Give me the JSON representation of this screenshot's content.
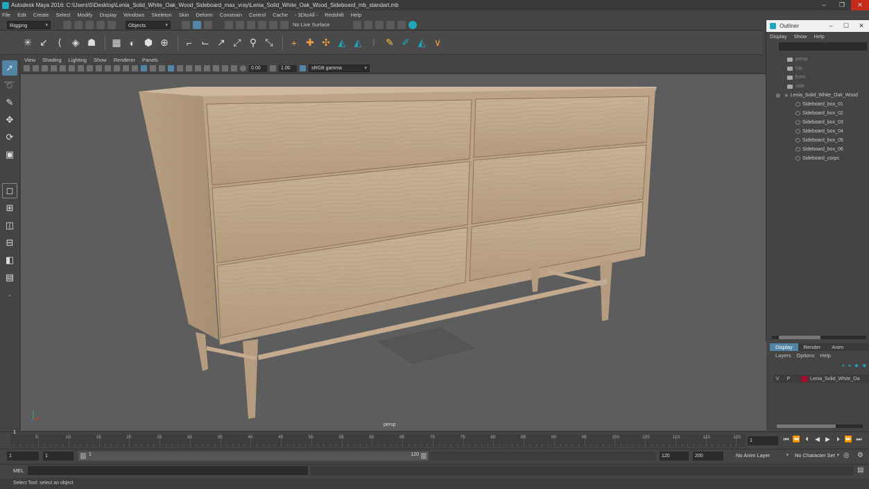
{
  "title": "Autodesk Maya 2016: C:\\Users\\5\\Desktop\\Lenia_Solid_White_Oak_Wood_Sideboard_max_vray\\Lenia_Solid_White_Oak_Wood_Sideboard_mb_standart.mb",
  "menus": [
    "File",
    "Edit",
    "Create",
    "Select",
    "Modify",
    "Display",
    "Windows",
    "Skeleton",
    "Skin",
    "Deform",
    "Constrain",
    "Control",
    "Cache",
    "- 3DtoAll -",
    "Redshift",
    "Help"
  ],
  "statusline": {
    "mode": "Rigging",
    "objects": "Objects",
    "live_surface": "No Live Surface"
  },
  "panel_menus": [
    "View",
    "Shading",
    "Lighting",
    "Show",
    "Renderer",
    "Panels"
  ],
  "panel_toolbar": {
    "exposure": "0.00",
    "gamma": "1.00",
    "colorspace": "sRGB gamma"
  },
  "viewport": {
    "camera_label": "persp"
  },
  "outliner": {
    "title": "Outliner",
    "menus": [
      "Display",
      "Show",
      "Help"
    ],
    "cameras": [
      "persp",
      "top",
      "front",
      "side"
    ],
    "group": "Lenia_Solid_White_Oak_Wood",
    "children": [
      "Sideboard_box_01",
      "Sideboard_box_02",
      "Sideboard_box_03",
      "Sideboard_box_04",
      "Sideboard_box_05",
      "Sideboard_box_06",
      "Sideboard_corps"
    ]
  },
  "layers": {
    "tabs": [
      "Display",
      "Render",
      "Anim"
    ],
    "menus": [
      "Layers",
      "Options",
      "Help"
    ],
    "row": {
      "v": "V",
      "p": "P",
      "name": "Lenia_Solid_White_Oa"
    }
  },
  "timeline": {
    "ticks": [
      "5",
      "10",
      "15",
      "20",
      "25",
      "30",
      "35",
      "40",
      "45",
      "50",
      "55",
      "60",
      "65",
      "70",
      "75",
      "80",
      "85",
      "90",
      "95",
      "100",
      "105",
      "110",
      "115",
      "120"
    ],
    "current": "1",
    "current_field": "1"
  },
  "range": {
    "start": "1",
    "start2": "1",
    "slider_start": "1",
    "slider_end": "120",
    "end": "120",
    "end2": "200",
    "anim_layer": "No Anim Layer",
    "character_set": "No Character Set"
  },
  "cmd": {
    "label": "MEL"
  },
  "help_text": "Select Tool: select an object"
}
